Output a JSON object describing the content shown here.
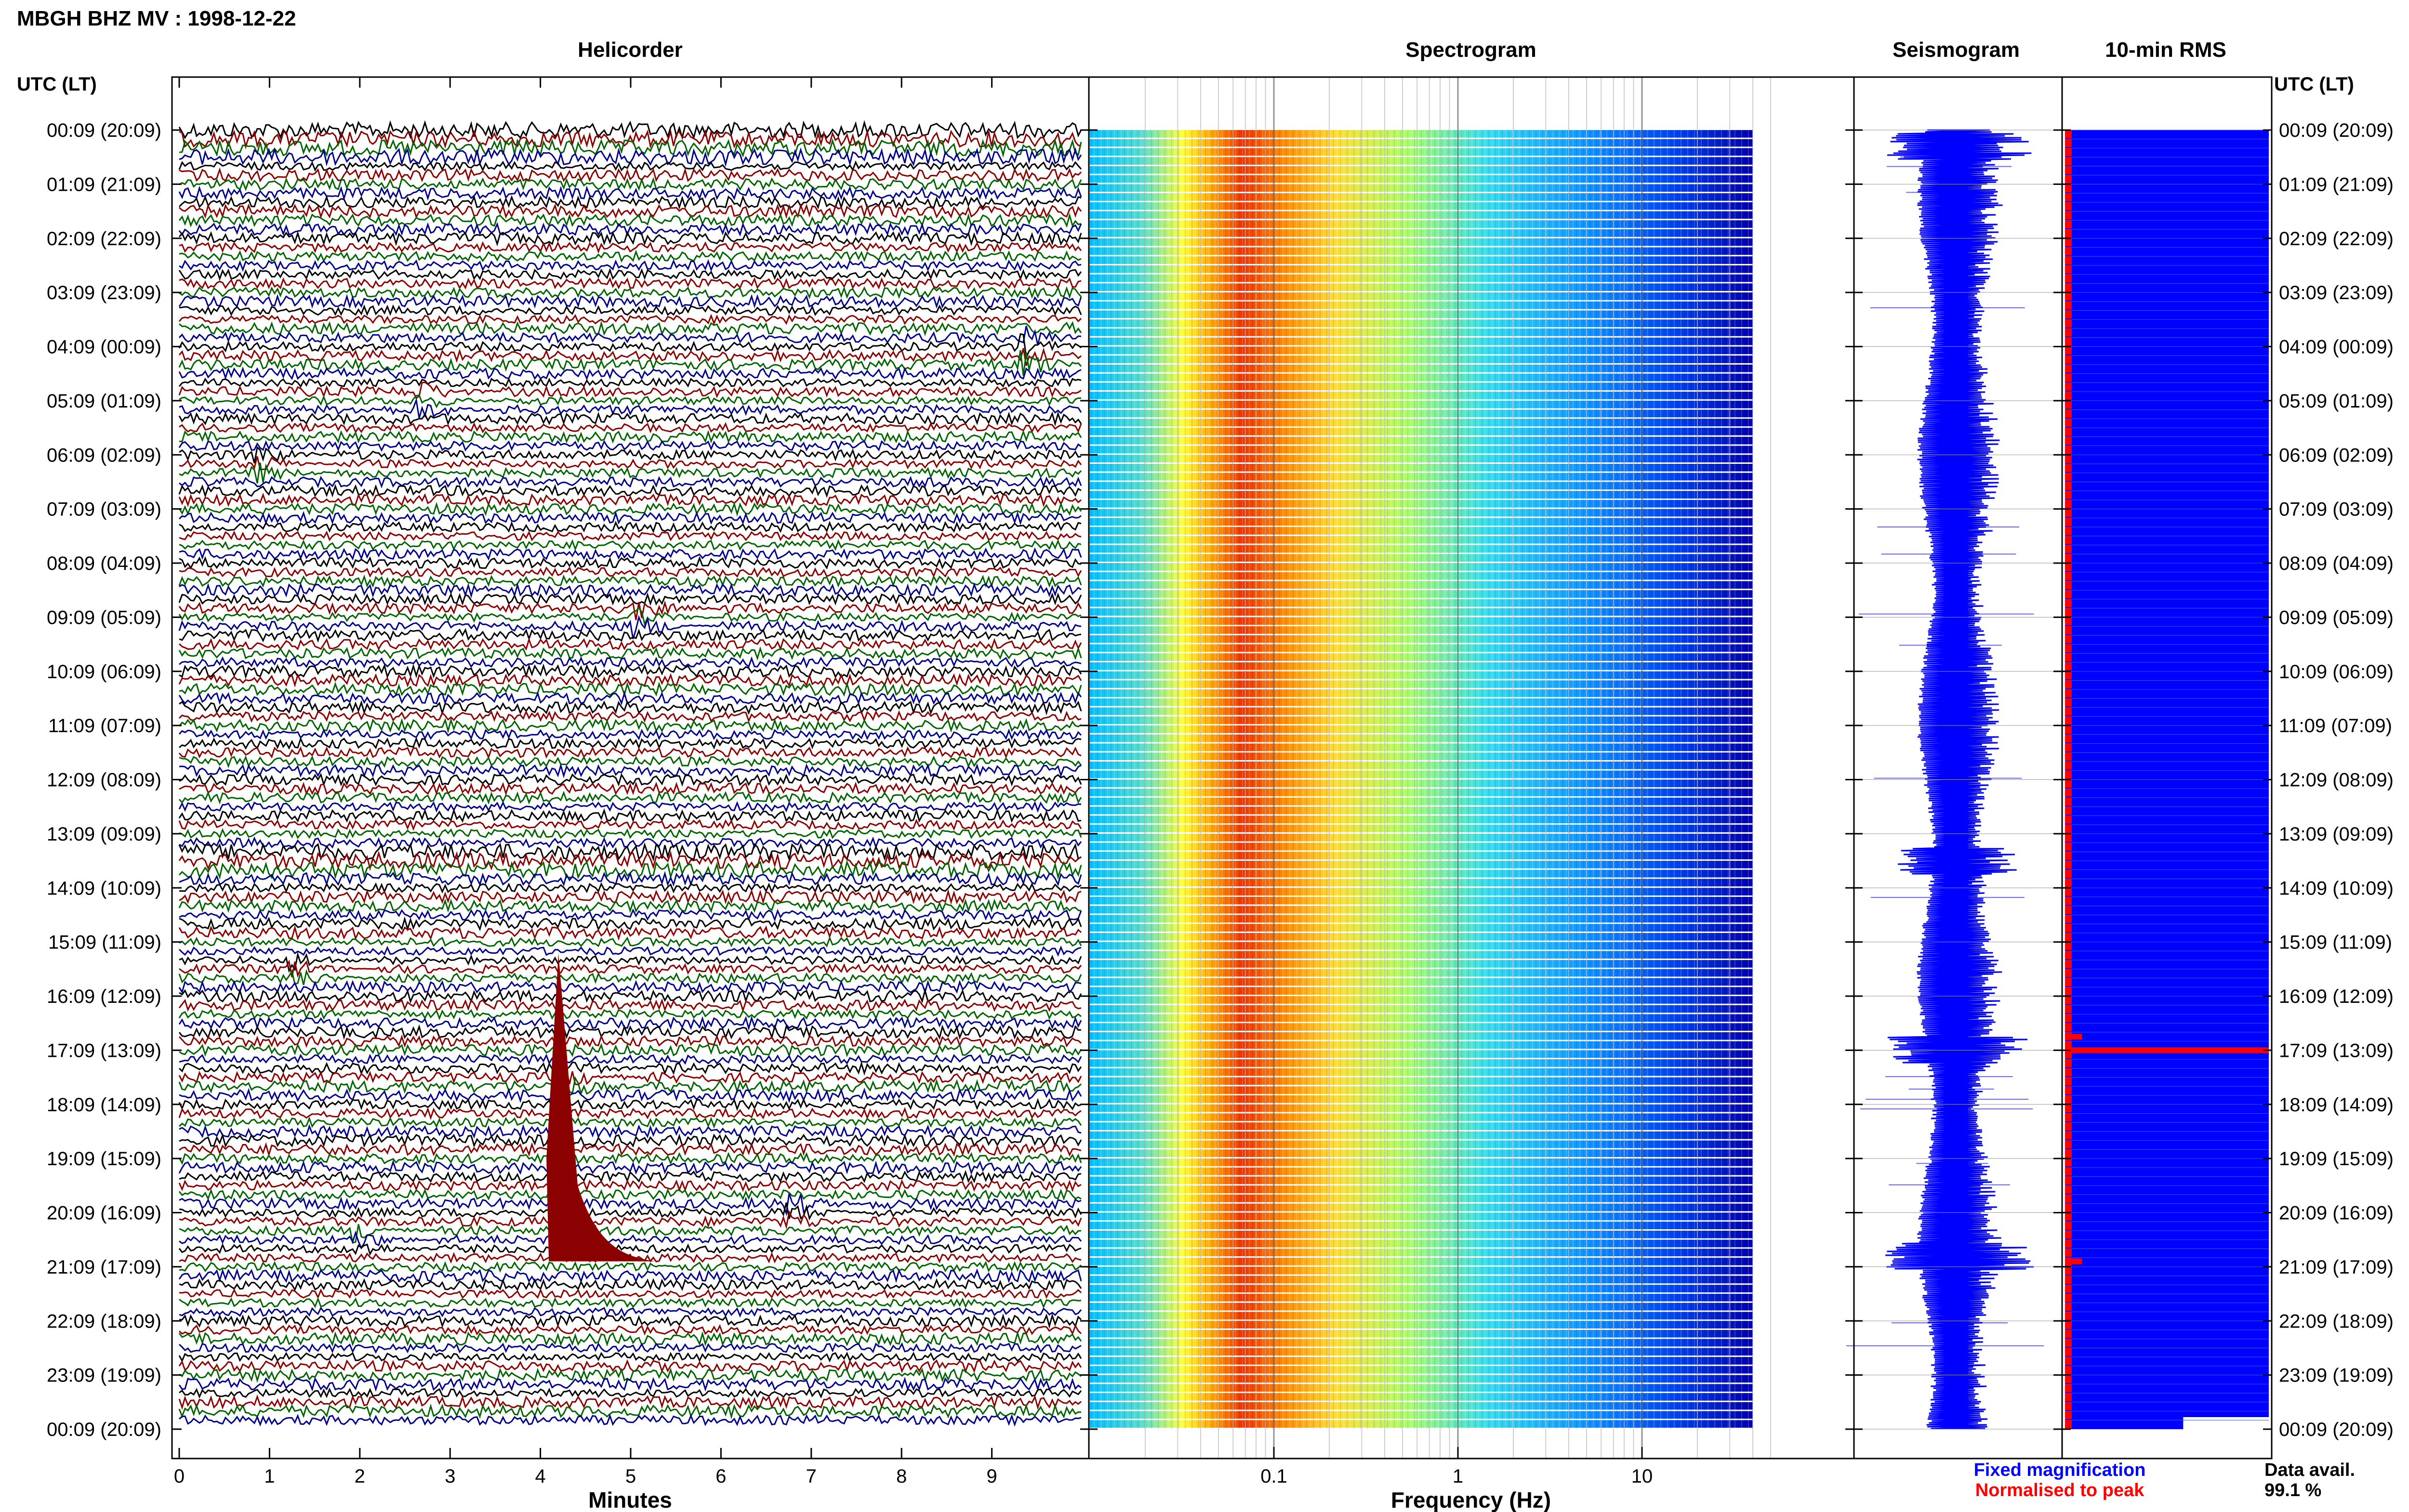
{
  "title": "MBGH BHZ MV : 1998-12-22",
  "colors": {
    "helicorder_traces": [
      "#000000",
      "#8b0000",
      "#006400",
      "#00008b"
    ],
    "seismogram": "#0000ff",
    "rms_fixed": "#0000ff",
    "rms_normalised": "#ff0000",
    "spectrogram_scale": [
      "#00007f",
      "#0000ff",
      "#00bfff",
      "#7fffd4",
      "#ffff00",
      "#ff7f00",
      "#ff0000"
    ]
  },
  "panels": {
    "helicorder": "Helicorder",
    "spectrogram": "Spectrogram",
    "seismogram": "Seismogram",
    "rms": "10-min RMS"
  },
  "axis_header_left": "UTC (LT)",
  "axis_header_right": "UTC (LT)",
  "legend": {
    "fixed": "Fixed magnification",
    "normalised": "Normalised to peak"
  },
  "data_avail": {
    "label": "Data avail.",
    "value": "99.1 %"
  },
  "chart_data": [
    {
      "type": "heatmap",
      "name": "helicorder",
      "title": "Helicorder",
      "xlabel": "Minutes",
      "x_ticks": [
        "0",
        "1",
        "2",
        "3",
        "4",
        "5",
        "6",
        "7",
        "8",
        "9"
      ],
      "xlim": [
        0,
        10
      ],
      "y_tick_labels": [
        "00:09 (20:09)",
        "01:09 (21:09)",
        "02:09 (22:09)",
        "03:09 (23:09)",
        "04:09 (00:09)",
        "05:09 (01:09)",
        "06:09 (02:09)",
        "07:09 (03:09)",
        "08:09 (04:09)",
        "09:09 (05:09)",
        "10:09 (06:09)",
        "11:09 (07:09)",
        "12:09 (08:09)",
        "13:09 (09:09)",
        "14:09 (10:09)",
        "15:09 (11:09)",
        "16:09 (12:09)",
        "17:09 (13:09)",
        "18:09 (14:09)",
        "19:09 (15:09)",
        "20:09 (16:09)",
        "21:09 (17:09)",
        "22:09 (18:09)",
        "23:09 (19:09)",
        "00:09 (20:09)"
      ],
      "rows_per_hour": 6,
      "events": [
        {
          "hour": 4.1,
          "minute": 9.3
        },
        {
          "hour": 5.0,
          "minute": 2.6
        },
        {
          "hour": 6.2,
          "minute": 0.8
        },
        {
          "hour": 9.0,
          "minute": 5.0
        },
        {
          "hour": 15.5,
          "minute": 1.2
        },
        {
          "hour": 17.5,
          "minute": 4.2
        },
        {
          "hour": 20.5,
          "minute": 1.9
        },
        {
          "hour": 20.0,
          "minute": 6.7
        }
      ]
    },
    {
      "type": "heatmap",
      "name": "spectrogram",
      "title": "Spectrogram",
      "xlabel": "Frequency (Hz)",
      "x_scale": "log",
      "x_ticks": [
        0.1,
        1,
        10
      ],
      "x_tick_labels": [
        "0.1",
        "1",
        "10"
      ],
      "xlim": [
        0.01,
        100
      ],
      "y_tick_labels": [
        "00:09 (20:09)",
        "01:09 (21:09)",
        "02:09 (22:09)",
        "03:09 (23:09)",
        "04:09 (00:09)",
        "05:09 (01:09)",
        "06:09 (02:09)",
        "07:09 (03:09)",
        "08:09 (04:09)",
        "09:09 (05:09)",
        "10:09 (06:09)",
        "11:09 (07:09)",
        "12:09 (08:09)",
        "13:09 (09:09)",
        "14:09 (10:09)",
        "15:09 (11:09)",
        "16:09 (12:09)",
        "17:09 (13:09)",
        "18:09 (14:09)",
        "19:09 (15:09)",
        "20:09 (16:09)",
        "21:09 (17:09)",
        "22:09 (18:09)",
        "23:09 (19:09)",
        "00:09 (20:09)"
      ],
      "data_freq_range": [
        0.01,
        40
      ],
      "peak_freq": 0.25
    },
    {
      "type": "line",
      "name": "seismogram",
      "title": "Seismogram",
      "y_tick_labels": [
        "00:09 (20:09)",
        "01:09 (21:09)",
        "02:09 (22:09)",
        "03:09 (23:09)",
        "04:09 (00:09)",
        "05:09 (01:09)",
        "06:09 (02:09)",
        "07:09 (03:09)",
        "08:09 (04:09)",
        "09:09 (05:09)",
        "10:09 (06:09)",
        "11:09 (07:09)",
        "12:09 (08:09)",
        "13:09 (09:09)",
        "14:09 (10:09)",
        "15:09 (11:09)",
        "16:09 (12:09)",
        "17:09 (13:09)",
        "18:09 (14:09)",
        "19:09 (15:09)",
        "20:09 (16:09)",
        "21:09 (17:09)",
        "22:09 (18:09)",
        "23:09 (19:09)",
        "00:09 (20:09)"
      ],
      "high_amplitude_hours": [
        0.3,
        13.5,
        17.0,
        20.8
      ]
    },
    {
      "type": "bar",
      "name": "rms",
      "title": "10-min RMS",
      "y_tick_labels": [
        "00:09 (20:09)",
        "01:09 (21:09)",
        "02:09 (22:09)",
        "03:09 (23:09)",
        "04:09 (00:09)",
        "05:09 (01:09)",
        "06:09 (02:09)",
        "07:09 (03:09)",
        "08:09 (04:09)",
        "09:09 (05:09)",
        "10:09 (06:09)",
        "11:09 (07:09)",
        "12:09 (08:09)",
        "13:09 (09:09)",
        "14:09 (10:09)",
        "15:09 (11:09)",
        "16:09 (12:09)",
        "17:09 (13:09)",
        "18:09 (14:09)",
        "19:09 (15:09)",
        "20:09 (16:09)",
        "21:09 (17:09)",
        "22:09 (18:09)",
        "23:09 (19:09)",
        "00:09 (20:09)"
      ],
      "series": [
        {
          "name": "Fixed magnification",
          "fraction_of_row_filled": 1.0
        },
        {
          "name": "Normalised to peak",
          "peak_hours": [
            16.75,
            17.0,
            20.9
          ]
        }
      ]
    }
  ]
}
